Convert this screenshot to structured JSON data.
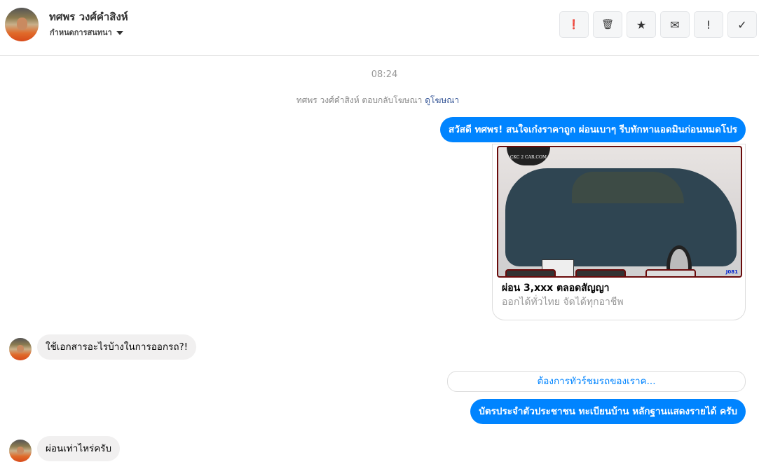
{
  "header": {
    "name": "ทศพร วงศ์คำสิงห์",
    "subtitle": "กำหนดการสนทนา",
    "buttons": [
      {
        "icon": "alert-circle-icon",
        "glyph": "❗"
      },
      {
        "icon": "trash-icon",
        "glyph": "🗑"
      },
      {
        "icon": "star-icon",
        "glyph": "★"
      },
      {
        "icon": "envelope-icon",
        "glyph": "✉"
      },
      {
        "icon": "exclamation-icon",
        "glyph": "!"
      },
      {
        "icon": "check-icon",
        "glyph": "✓"
      }
    ]
  },
  "chat": {
    "time": "08:24",
    "ad_reply": "ทศพร วงศ์คำสิงห์ ตอบกลับโฆษณา",
    "ad_link": "ดูโฆษณา",
    "messages": [
      {
        "dir": "out",
        "text": "สวัสดี ทศพร! สนใจเก๋งราคาถูก ผ่อนเบาๆ รีบทักหาแอดมินก่อนหมดโปร"
      },
      {
        "dir": "in",
        "text": "ใช้เอกสารอะไรบ้างในการออกรถ?!"
      },
      {
        "dir": "out",
        "text": "บัตรประจำตัวประชาชน ทะเบียนบ้าน หลักฐานแสดงรายได้ ครับ"
      },
      {
        "dir": "in",
        "text": "ผ่อนเท่าไหร่ครับ"
      }
    ],
    "card": {
      "logo": "CKC 2 CAR.COM",
      "code": "J081",
      "title": "ผ่อน 3,xxx ตลอดสัญญา",
      "subtitle": "ออกได้ทั่วไทย จัดได้ทุกอาชีพ"
    },
    "quick_reply": "ต้องการทัวร์ชมรถของเราค..."
  },
  "colors": {
    "accent": "#0084ff",
    "incoming": "#f1f0f0"
  }
}
